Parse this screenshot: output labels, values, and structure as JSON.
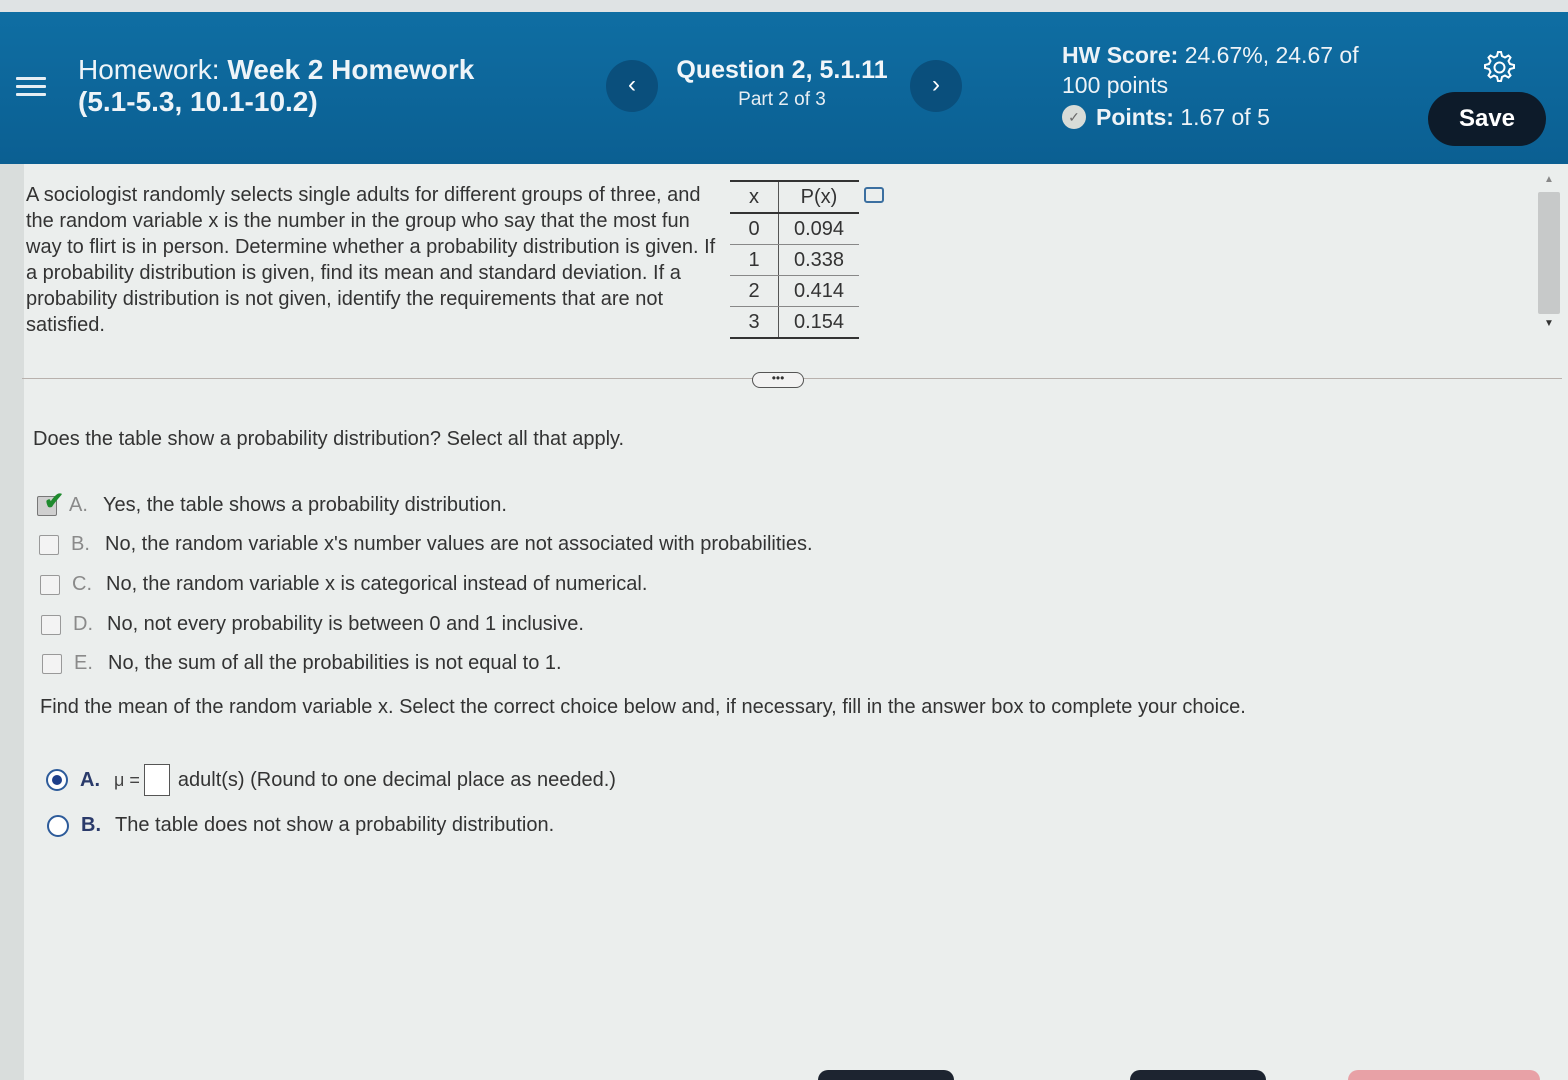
{
  "header": {
    "homework_prefix": "Homework:",
    "homework_name": "Week 2 Homework",
    "homework_sections": "(5.1-5.3, 10.1-10.2)",
    "prev_label": "‹",
    "next_label": "›",
    "question_label": "Question 2, 5.1.11",
    "part_label": "Part 2 of 3",
    "hw_score_label": "HW Score:",
    "hw_score_value": "24.67%, 24.67 of",
    "hw_score_total": "100 points",
    "points_label": "Points:",
    "points_value": "1.67 of 5",
    "save_label": "Save",
    "icons": [
      "menu-icon",
      "gear-icon",
      "partial-credit-icon",
      "copy-icon"
    ]
  },
  "problem": {
    "text": "A sociologist randomly selects single adults for different groups of three, and the random variable x is the number in the group who say that the most fun way to flirt is in person. Determine whether a probability distribution is given. If a probability distribution is given, find its mean and standard deviation. If a probability distribution is not given, identify the requirements that are not satisfied.",
    "table": {
      "headers": [
        "x",
        "P(x)"
      ],
      "rows": [
        [
          "0",
          "0.094"
        ],
        [
          "1",
          "0.338"
        ],
        [
          "2",
          "0.414"
        ],
        [
          "3",
          "0.154"
        ]
      ]
    },
    "expand_label": "•••"
  },
  "question1": {
    "prompt": "Does the table show a probability distribution? Select all that apply.",
    "options": [
      {
        "letter": "A.",
        "text": "Yes, the table shows a probability distribution."
      },
      {
        "letter": "B.",
        "text": "No, the random variable x's number values are not associated with probabilities."
      },
      {
        "letter": "C.",
        "text": "No, the random variable x is categorical instead of numerical."
      },
      {
        "letter": "D.",
        "text": "No, not every probability is between 0 and 1 inclusive."
      },
      {
        "letter": "E.",
        "text": "No, the sum of all the probabilities is not equal to 1."
      }
    ]
  },
  "question2": {
    "prompt": "Find the mean of the random variable x. Select the correct choice below and, if necessary, fill in the answer box to complete your choice.",
    "option_a_letter": "A.",
    "option_a_mu": "μ =",
    "option_a_suffix": "adult(s) (Round to one decimal place as needed.)",
    "option_b_letter": "B.",
    "option_b_text": "The table does not show a probability distribution."
  },
  "colors": {
    "header_bg": "#0b5f92",
    "save_bg": "#0d1b2a",
    "check_green": "#1f8a2e",
    "radio_blue": "#1e3f8a"
  }
}
